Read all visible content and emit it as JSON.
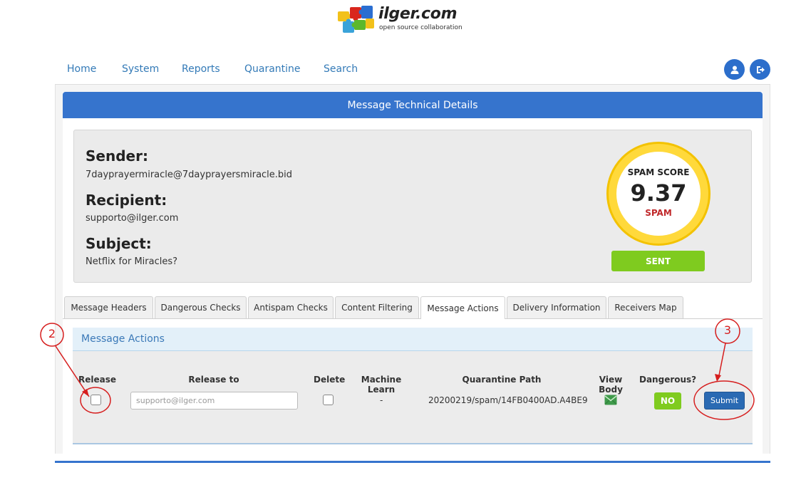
{
  "brand": {
    "name": "ilger.com",
    "tagline": "open source collaboration"
  },
  "nav": {
    "items": [
      "Home",
      "System",
      "Reports",
      "Quarantine",
      "Search"
    ],
    "icons": [
      "user-icon",
      "logout-icon"
    ],
    "accent_color": "#2c6ecb"
  },
  "panel": {
    "title": "Message Technical Details"
  },
  "message": {
    "sender_label": "Sender:",
    "sender": "7dayprayermiracle@7dayprayersmiracle.bid",
    "recipient_label": "Recipient:",
    "recipient": "supporto@ilger.com",
    "subject_label": "Subject:",
    "subject": "Netflix for Miracles?"
  },
  "spam": {
    "title": "SPAM SCORE",
    "score": "9.37",
    "verdict": "SPAM",
    "status": "SENT",
    "ring_color": "#ffd93b",
    "status_color": "#7fcb1f"
  },
  "tabs": {
    "items": [
      "Message Headers",
      "Dangerous Checks",
      "Antispam Checks",
      "Content Filtering",
      "Message Actions",
      "Delivery Information",
      "Receivers Map"
    ],
    "active": "Message Actions"
  },
  "actions": {
    "title": "Message Actions",
    "headers": {
      "release": "Release",
      "release_to": "Release to",
      "delete": "Delete",
      "machine_learn": "Machine Learn",
      "quarantine_path": "Quarantine Path",
      "view_body": "View Body",
      "dangerous": "Dangerous?"
    },
    "row": {
      "release_checked": false,
      "release_to_placeholder": "supporto@ilger.com",
      "delete_checked": false,
      "machine_learn": "-",
      "quarantine_path": "20200219/spam/14FB0400AD.A4BE9",
      "view_body_icon": "envelope-icon",
      "dangerous": "NO"
    },
    "submit_label": "Submit"
  },
  "annotations": {
    "labels": [
      "2",
      "3"
    ],
    "color": "#d61e1e"
  }
}
